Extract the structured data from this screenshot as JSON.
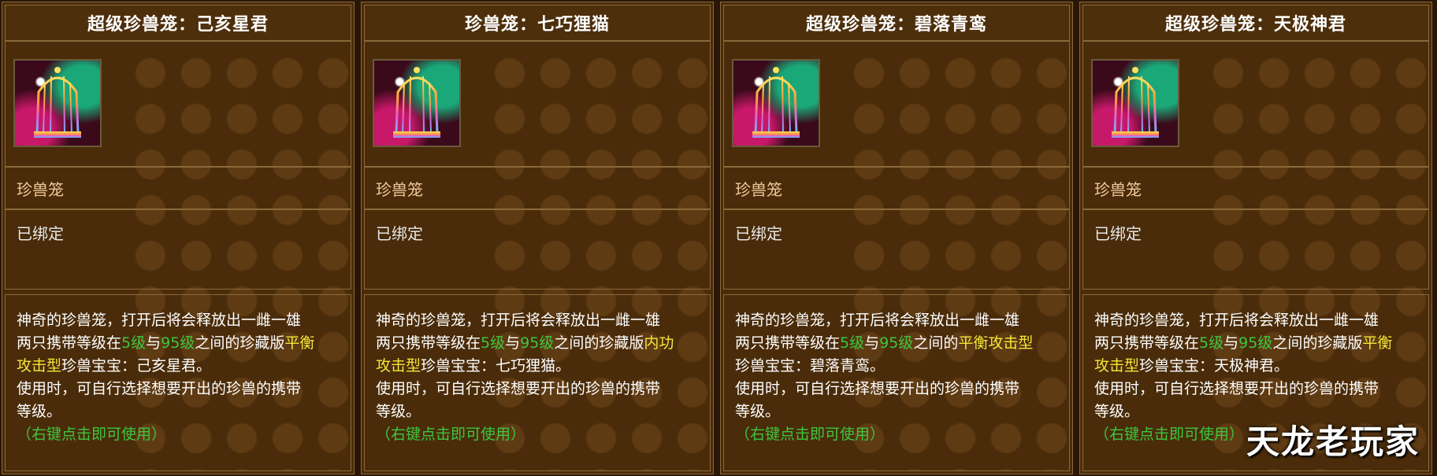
{
  "watermark": "天龙老玩家",
  "tooltips": [
    {
      "title": "超级珍兽笼：己亥星君",
      "item_type": "珍兽笼",
      "bind_status": "已绑定",
      "desc": {
        "l1": "神奇的珍兽笼，打开后将会释放出一雌一雄",
        "l2_a": "两只携带等级在",
        "lvl_min": "5级",
        "l2_b": "与",
        "lvl_max": "95级",
        "l2_c": "之间的珍藏版",
        "type_a": "平衡",
        "type_b": "攻击型",
        "l3_tail": "珍兽宝宝：己亥星君。",
        "l4": "使用时，可自行选择想要开出的珍兽的携带",
        "l5": "等级。",
        "hint": "（右键点击即可使用）"
      }
    },
    {
      "title": "珍兽笼：七巧狸猫",
      "item_type": "珍兽笼",
      "bind_status": "已绑定",
      "desc": {
        "l1": "神奇的珍兽笼，打开后将会释放出一雌一雄",
        "l2_a": "两只携带等级在",
        "lvl_min": "5级",
        "l2_b": "与",
        "lvl_max": "95级",
        "l2_c": "之间的珍藏版",
        "type_a": "内功",
        "type_b": "攻击型",
        "l3_tail": "珍兽宝宝：七巧狸猫。",
        "l4": "使用时，可自行选择想要开出的珍兽的携带",
        "l5": "等级。",
        "hint": "（右键点击即可使用）"
      }
    },
    {
      "title": "超级珍兽笼：碧落青鸾",
      "item_type": "珍兽笼",
      "bind_status": "已绑定",
      "desc": {
        "l1": "神奇的珍兽笼，打开后将会释放出一雌一雄",
        "l2_a": "两只携带等级在",
        "lvl_min": "5级",
        "l2_b": "与",
        "lvl_max": "95级",
        "l2_c": "之间的",
        "type_a": "平衡攻击型",
        "type_b": "",
        "l3_tail": "珍兽宝宝：碧落青鸾。",
        "l4": "使用时，可自行选择想要开出的珍兽的携带",
        "l5": "等级。",
        "hint": "（右键点击即可使用）"
      }
    },
    {
      "title": "超级珍兽笼：天极神君",
      "item_type": "珍兽笼",
      "bind_status": "已绑定",
      "desc": {
        "l1": "神奇的珍兽笼，打开后将会释放出一雌一雄",
        "l2_a": "两只携带等级在",
        "lvl_min": "5级",
        "l2_b": "与",
        "lvl_max": "95级",
        "l2_c": "之间的珍藏版",
        "type_a": "平衡",
        "type_b": "攻击型",
        "l3_tail": "珍兽宝宝：天极神君。",
        "l4": "使用时，可自行选择想要开出的珍兽的携带",
        "l5": "等级。",
        "hint": "（右键点击即可使用）"
      }
    }
  ]
}
